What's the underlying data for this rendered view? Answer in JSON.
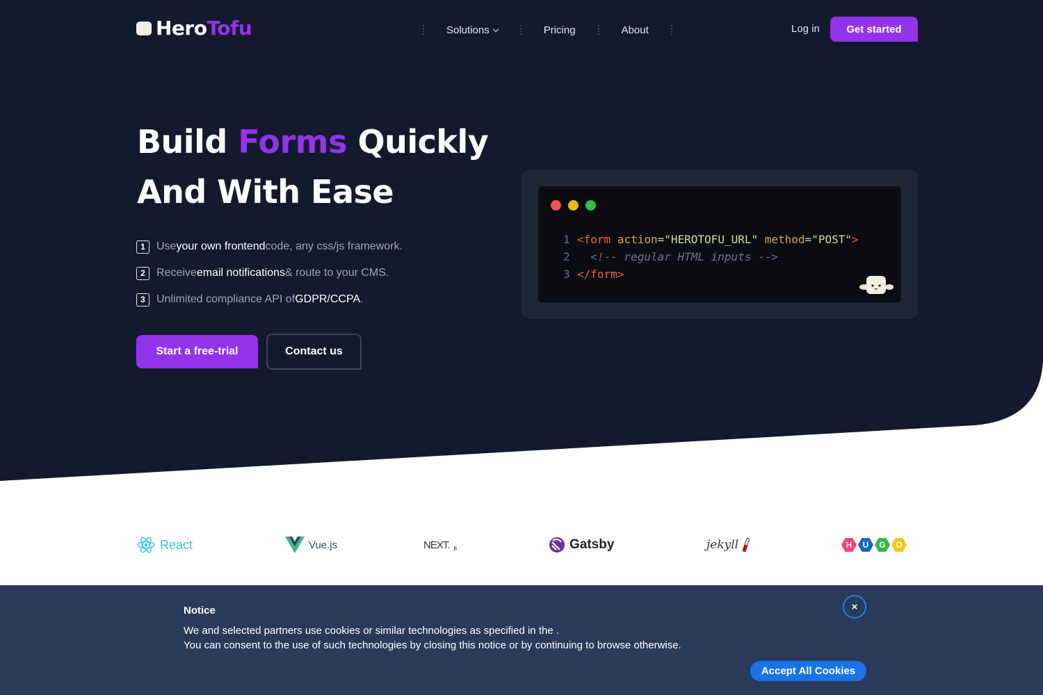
{
  "colors": {
    "hero_bg": "#131a2e",
    "accent": "#9333ea",
    "notice_bg": "#2a3a5a",
    "accept_button": "#1a73e8"
  },
  "nav": {
    "logo_part1": "Hero",
    "logo_part2": "Tofu",
    "links": [
      "Solutions",
      "Pricing",
      "About"
    ],
    "login": "Log in",
    "cta": "Get started"
  },
  "hero": {
    "headline_word1": "Build",
    "headline_accent": "Forms",
    "headline_word3": "Quickly",
    "headline_line2": "And With Ease",
    "features": [
      {
        "num": "1",
        "parts": [
          "Use ",
          "your own frontend",
          " code, any css/js framework."
        ]
      },
      {
        "num": "2",
        "parts": [
          "Receive ",
          "email notifications",
          " & route to your CMS."
        ]
      },
      {
        "num": "3",
        "parts": [
          "Unlimited compliance API of ",
          "GDPR/CCPA",
          "."
        ]
      }
    ],
    "primary_button": "Start a free-trial",
    "secondary_button": "Contact us"
  },
  "code": {
    "dots": [
      "#ef5350",
      "#f5b31b",
      "#2fbf4b"
    ],
    "line_numbers": [
      "1",
      "2",
      "3"
    ],
    "line1": {
      "open": "<form",
      "attr1": "action",
      "val1": "\"HEROTOFU_URL\"",
      "attr2": "method",
      "val2": "\"POST\"",
      "close": ">"
    },
    "line2": "<!-- regular HTML inputs -->",
    "line3": "</form>"
  },
  "frameworks": {
    "react": "React",
    "vue": "Vue.js",
    "next": "NEXT.",
    "next_suffix": "js",
    "gatsby": "Gatsby",
    "jekyll": "jekyll",
    "hugo_letters": [
      "H",
      "U",
      "G",
      "O"
    ],
    "hugo_colors": [
      "#ff3d7f",
      "#1565c0",
      "#33b74a",
      "#f5c518"
    ]
  },
  "notice": {
    "title": "Notice",
    "line1": "We and selected partners use cookies or similar technologies as specified in the .",
    "line2": "You can consent to the use of such technologies by closing this notice or by continuing to browse otherwise.",
    "close_symbol": "×",
    "accept_button": "Accept All Cookies"
  }
}
